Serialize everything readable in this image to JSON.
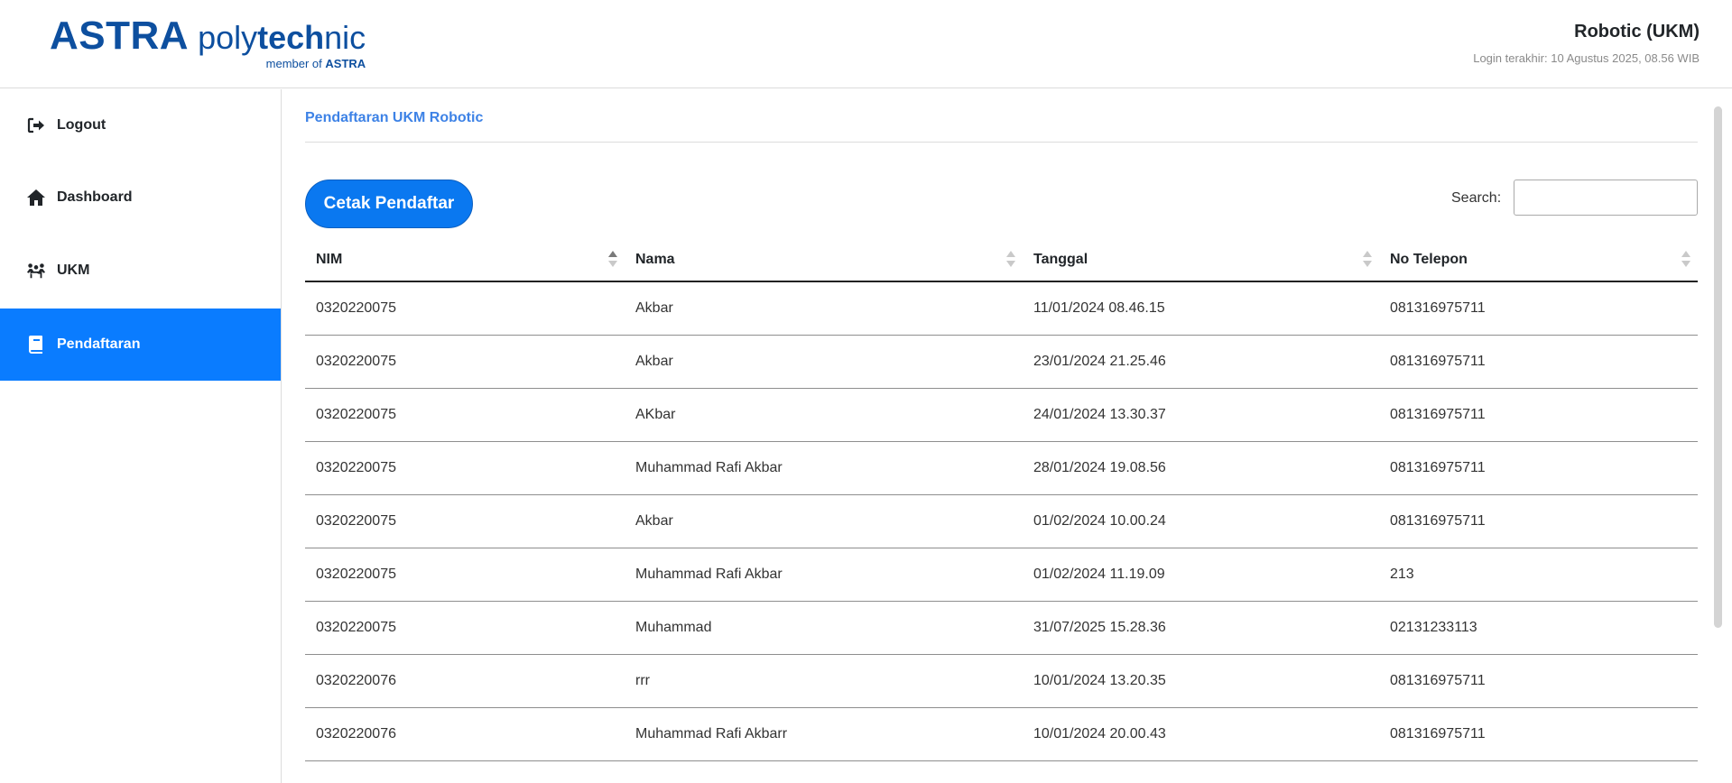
{
  "header": {
    "logo_main": "ASTRA",
    "logo_poly_a": "poly",
    "logo_poly_b": "tech",
    "logo_poly_c": "nic",
    "logo_sub_a": "member of ",
    "logo_sub_b": "ASTRA",
    "user_name": "Robotic (UKM)",
    "login_info": "Login terakhir: 10 Agustus 2025, 08.56 WIB"
  },
  "sidebar": {
    "items": [
      {
        "label": "Logout",
        "icon": "logout-icon"
      },
      {
        "label": "Dashboard",
        "icon": "home-icon"
      },
      {
        "label": "UKM",
        "icon": "group-icon"
      },
      {
        "label": "Pendaftaran",
        "icon": "book-icon",
        "active": true
      }
    ]
  },
  "main": {
    "title": "Pendaftaran UKM Robotic",
    "print_button": "Cetak Pendaftar",
    "search_label": "Search:",
    "search_value": ""
  },
  "table": {
    "columns": [
      "NIM",
      "Nama",
      "Tanggal",
      "No Telepon"
    ],
    "sorted_column": "NIM",
    "sort_direction": "asc",
    "rows": [
      [
        "0320220075",
        "Akbar",
        "11/01/2024 08.46.15",
        "081316975711"
      ],
      [
        "0320220075",
        "Akbar",
        "23/01/2024 21.25.46",
        "081316975711"
      ],
      [
        "0320220075",
        "AKbar",
        "24/01/2024 13.30.37",
        "081316975711"
      ],
      [
        "0320220075",
        "Muhammad Rafi Akbar",
        "28/01/2024 19.08.56",
        "081316975711"
      ],
      [
        "0320220075",
        "Akbar",
        "01/02/2024 10.00.24",
        "081316975711"
      ],
      [
        "0320220075",
        "Muhammad Rafi Akbar",
        "01/02/2024 11.19.09",
        "213"
      ],
      [
        "0320220075",
        "Muhammad",
        "31/07/2025 15.28.36",
        "02131233113"
      ],
      [
        "0320220076",
        "rrr",
        "10/01/2024 13.20.35",
        "081316975711"
      ],
      [
        "0320220076",
        "Muhammad Rafi Akbarr",
        "10/01/2024 20.00.43",
        "081316975711"
      ]
    ]
  },
  "colors": {
    "brand_blue": "#0d4f9f",
    "active_blue": "#0a7cff",
    "title_blue": "#3d82e6",
    "button_blue": "#0a78f0"
  }
}
